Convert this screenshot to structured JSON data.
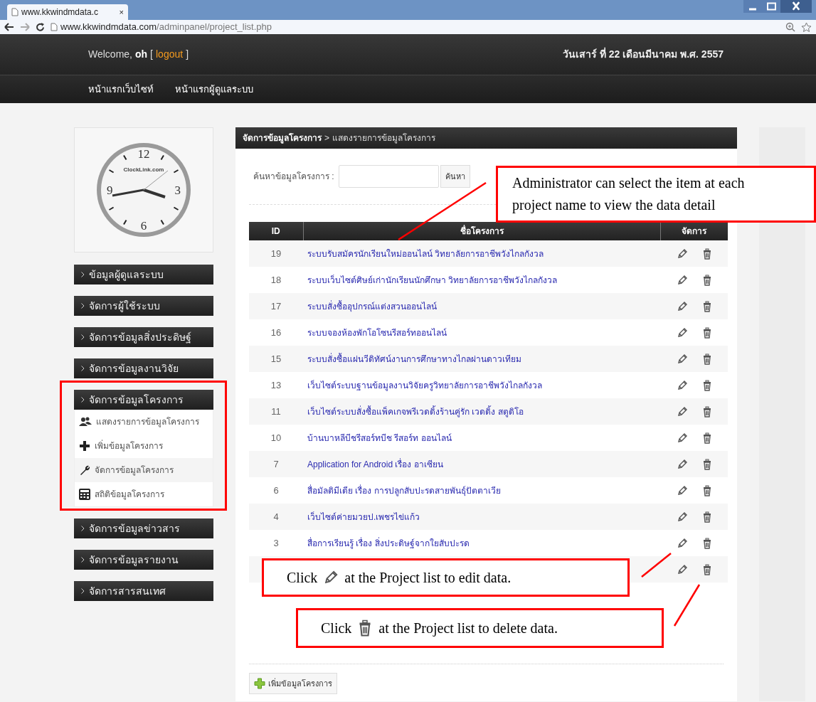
{
  "browser": {
    "tab_title": "www.kkwindmdata.c",
    "tab_close": "×",
    "url_host": "www.kkwindmdata.com",
    "url_path": "/adminpanel/project_list.php"
  },
  "header": {
    "welcome": "Welcome,",
    "user": "oh",
    "bracket_open": "[",
    "logout": "logout",
    "bracket_close": "]",
    "date": "วันเสาร์ ที่ 22 เดือนมีนาคม พ.ศ. 2557"
  },
  "nav": [
    "หน้าแรกเว็บไซท์",
    "หน้าแรกผู้ดูแลระบบ"
  ],
  "clock": {
    "brand": "ClockLink.com",
    "numerals": [
      "12",
      "3",
      "6",
      "9"
    ]
  },
  "sidebar": {
    "items": [
      {
        "label": "ข้อมูลผู้ดูแลระบบ",
        "expanded": false
      },
      {
        "label": "จัดการผู้ใช้ระบบ",
        "expanded": false
      },
      {
        "label": "จัดการข้อมูลสิ่งประดิษฐ์",
        "expanded": false
      },
      {
        "label": "จัดการข้อมูลงานวิจัย",
        "expanded": false
      },
      {
        "label": "จัดการข้อมูลโครงการ",
        "expanded": true,
        "children": [
          {
            "label": "แสดงรายการข้อมูลโครงการ",
            "kind": "users"
          },
          {
            "label": "เพิ่มข้อมูลโครงการ",
            "kind": "plus"
          },
          {
            "label": "จัดการข้อมูลโครงการ",
            "kind": "wrench"
          },
          {
            "label": "สถิติข้อมูลโครงการ",
            "kind": "calculator"
          }
        ]
      },
      {
        "label": "จัดการข้อมูลข่าวสาร",
        "expanded": false
      },
      {
        "label": "จัดการข้อมูลรายงาน",
        "expanded": false
      },
      {
        "label": "จัดการสารสนเทศ",
        "expanded": false
      }
    ]
  },
  "breadcrumb": {
    "section": "จัดการข้อมูลโครงการ",
    "separator": ">",
    "page": "แสดงรายการข้อมูลโครงการ"
  },
  "search": {
    "label": "ค้นหาข้อมูลโครงการ :",
    "button": "ค้นหา"
  },
  "table": {
    "columns": [
      "ID",
      "ชื่อโครงการ",
      "จัดการ"
    ],
    "rows": [
      {
        "id": "19",
        "name": "ระบบรับสมัครนักเรียนใหม่ออนไลน์ วิทยาลัยการอาชีพวังไกลกังวล"
      },
      {
        "id": "18",
        "name": "ระบบเว็บไซต์ศิษย์เก่านักเรียนนักศึกษา วิทยาลัยการอาชีพวังไกลกังวล"
      },
      {
        "id": "17",
        "name": "ระบบสั่งซื้ออุปกรณ์แต่งสวนออนไลน์"
      },
      {
        "id": "16",
        "name": "ระบบจองห้องพักโอโซนรีสอร์ทออนไลน์"
      },
      {
        "id": "15",
        "name": "ระบบสั่งซื้อแผ่นวีดิทัศน์งานการศึกษาทางไกลผ่านดาวเทียม"
      },
      {
        "id": "13",
        "name": "เว็บไซต์ระบบฐานข้อมูลงานวิจัยครูวิทยาลัยการอาชีพวังไกลกังวล"
      },
      {
        "id": "11",
        "name": "เว็บไซต์ระบบสั่งซื้อแพ็คเกจพรีเวดดิ้งร้านคู่รัก เวดดิ้ง สตูดิโอ"
      },
      {
        "id": "10",
        "name": "บ้านบาหลีบีชรีสอร์ทบีช รีสอร์ท ออนไลน์"
      },
      {
        "id": "7",
        "name": "Application for Android เรื่อง อาเซียน"
      },
      {
        "id": "6",
        "name": "สื่อมัลติมีเดีย เรื่อง การปลูกสับปะรดสายพันธุ์ปัตตาเวีย"
      },
      {
        "id": "4",
        "name": "เว็บไซต์ค่ายมวยป.เพชรไข่แก้ว"
      },
      {
        "id": "3",
        "name": "สื่อการเรียนรู้ เรื่อง สิ่งประดิษฐ์จากใยสับปะรด"
      },
      {
        "kind": "actions_only"
      }
    ]
  },
  "add_button": "เพิ่มข้อมูลโครงการ",
  "annotations": [
    {
      "kind": "callout",
      "text": "Administrator can select the item at each project name to view the data detail"
    },
    {
      "kind": "frame"
    },
    {
      "kind": "edit_callout",
      "before": "Click",
      "after": "at the Project list to edit data."
    },
    {
      "kind": "delete_callout",
      "before": "Click",
      "after": "at the Project list to delete data."
    }
  ]
}
